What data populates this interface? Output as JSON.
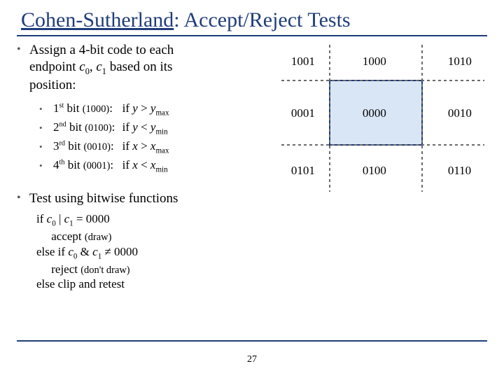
{
  "title_prefix": "Cohen-Sutherland",
  "title_suffix": ": Accept/Reject Tests",
  "top_bullet_l1": "Assign a 4-bit code to each",
  "top_bullet_l2a": "endpoint ",
  "top_bullet_l2b": ", ",
  "top_bullet_l2c": " based on its",
  "top_bullet_l2_c0": "c",
  "top_bullet_l2_c1": "c",
  "top_bullet_l3": "position:",
  "sub": [
    {
      "n": "1",
      "ord": "st",
      "code": "(1000)",
      "cond_lhs": "y",
      "op": ">",
      "rhs": "y",
      "rsub": "max"
    },
    {
      "n": "2",
      "ord": "nd",
      "code": "(0100)",
      "cond_lhs": "y",
      "op": "<",
      "rhs": "y",
      "rsub": "min"
    },
    {
      "n": "3",
      "ord": "rd",
      "code": "(0010)",
      "cond_lhs": "x",
      "op": ">",
      "rhs": "x",
      "rsub": "max"
    },
    {
      "n": "4",
      "ord": "th",
      "code": "(0001)",
      "cond_lhs": "x",
      "op": "<",
      "rhs": "x",
      "rsub": "min"
    }
  ],
  "bit_word": " bit ",
  "if_word": "if ",
  "test_bullet": "Test using bitwise functions",
  "pseudo": {
    "l1a": "if ",
    "l1_c0": "c",
    "l1_mid": " | ",
    "l1_c1": "c",
    "l1b": " = 0000",
    "l2a": "accept ",
    "l2b": "(draw)",
    "l3a": "else if ",
    "l3_c0": "c",
    "l3_mid": " & ",
    "l3_c1": "c",
    "l3b": " ≠ 0000",
    "l4a": "reject ",
    "l4b": "(don't draw)",
    "l5": "else clip and retest"
  },
  "grid": {
    "codes": [
      [
        "1001",
        "1000",
        "1010"
      ],
      [
        "0001",
        "0000",
        "0010"
      ],
      [
        "0101",
        "0100",
        "0110"
      ]
    ]
  },
  "page_number": "27"
}
